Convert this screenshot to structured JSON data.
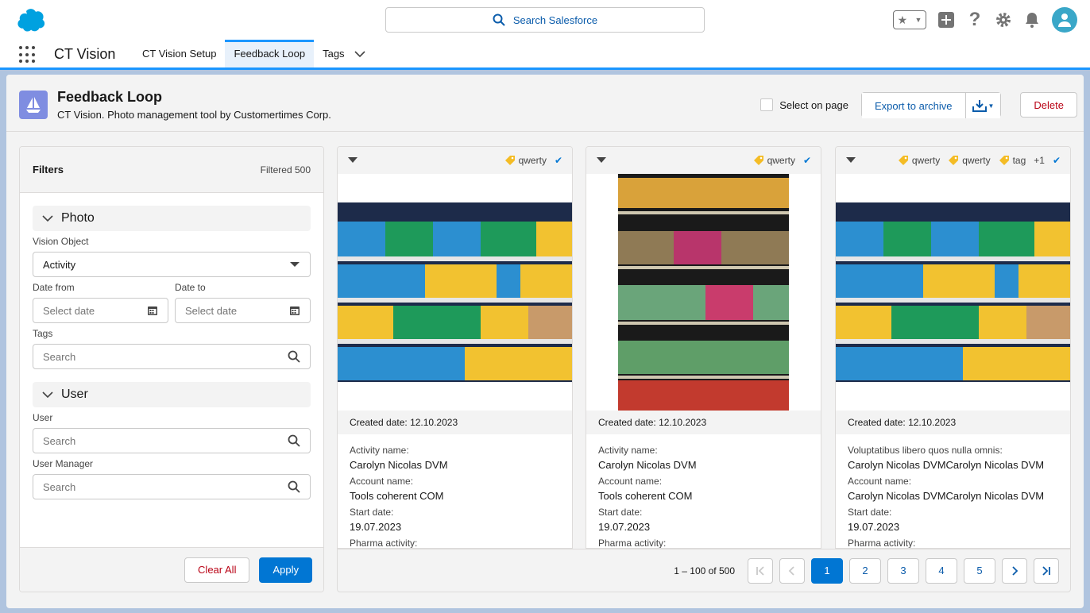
{
  "header": {
    "search_placeholder": "Search Salesforce"
  },
  "nav": {
    "app_name": "CT Vision",
    "tabs": [
      {
        "label": "CT Vision Setup"
      },
      {
        "label": "Feedback Loop"
      },
      {
        "label": "Tags"
      }
    ]
  },
  "page": {
    "title": "Feedback Loop",
    "subtitle": "CT Vision. Photo management tool by Customertimes Corp.",
    "select_on_page": "Select on page",
    "export_label": "Export to archive",
    "delete_label": "Delete"
  },
  "filters": {
    "title": "Filters",
    "count": "Filtered 500",
    "photo_section": "Photo",
    "vision_object_label": "Vision Object",
    "vision_object_value": "Activity",
    "date_from_label": "Date from",
    "date_to_label": "Date to",
    "date_placeholder": "Select date",
    "tags_label": "Tags",
    "search_placeholder": "Search",
    "user_section": "User",
    "user_label": "User",
    "user_manager_label": "User Manager",
    "clear_label": "Clear All",
    "apply_label": "Apply"
  },
  "cards": [
    {
      "tags": [
        "qwerty"
      ],
      "created_label": "Created date:",
      "created": "12.10.2023",
      "f1_label": "Activity name:",
      "f1_value": "Carolyn Nicolas DVM",
      "f2_label": "Account name:",
      "f2_value": "Tools coherent COM",
      "f3_label": "Start date:",
      "f3_value": "19.07.2023",
      "f4_label": "Pharma activity:"
    },
    {
      "tags": [
        "qwerty"
      ],
      "created_label": "Created date:",
      "created": "12.10.2023",
      "f1_label": "Activity name:",
      "f1_value": "Carolyn Nicolas DVM",
      "f2_label": "Account name:",
      "f2_value": "Tools coherent COM",
      "f3_label": "Start date:",
      "f3_value": "19.07.2023",
      "f4_label": "Pharma activity:"
    },
    {
      "tags": [
        "qwerty",
        "qwerty",
        "tag"
      ],
      "more": "+1",
      "created_label": "Created date:",
      "created": "12.10.2023",
      "f1_label": "Voluptatibus libero quos nulla omnis:",
      "f1_value": "Carolyn Nicolas DVMCarolyn Nicolas DVM",
      "f2_label": "Account name:",
      "f2_value": "Carolyn Nicolas DVMCarolyn Nicolas DVM",
      "f3_label": "Start date:",
      "f3_value": "19.07.2023",
      "f4_label": "Pharma activity:"
    }
  ],
  "pager": {
    "info": "1 – 100 of 500",
    "pages": [
      "1",
      "2",
      "3",
      "4",
      "5"
    ]
  }
}
